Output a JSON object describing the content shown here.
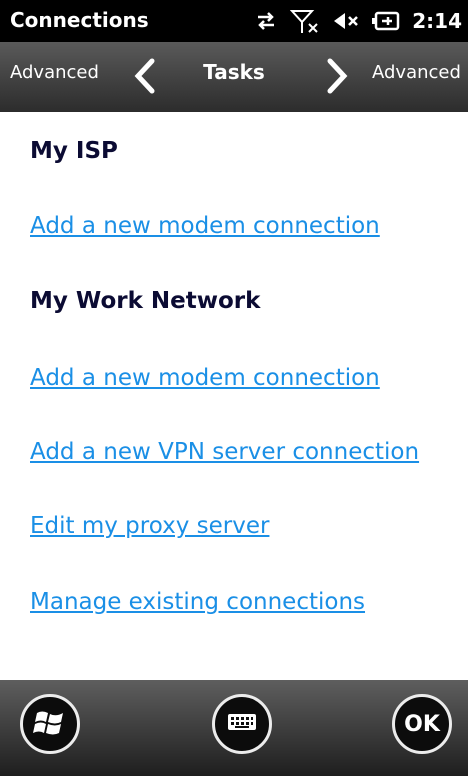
{
  "status_bar": {
    "title": "Connections",
    "time": "2:14",
    "icons": [
      "data-transfer-icon",
      "no-signal-icon",
      "speaker-muted-icon",
      "battery-charging-icon"
    ]
  },
  "tab_bar": {
    "previous": "Advanced",
    "current": "Tasks",
    "next": "Advanced"
  },
  "content": {
    "sections": [
      {
        "title": "My ISP",
        "links": [
          "Add a new modem connection"
        ]
      },
      {
        "title": "My Work Network",
        "links": [
          "Add a new modem connection",
          "Add a new VPN server connection",
          "Edit my proxy server"
        ]
      }
    ],
    "extra_link": "Manage existing connections"
  },
  "bottom_bar": {
    "ok_label": "OK",
    "buttons": [
      "windows-start-icon",
      "keyboard-icon",
      "ok-button"
    ]
  },
  "colors": {
    "link": "#1a8fe6",
    "heading": "#0b0b33",
    "background": "#ffffff"
  }
}
